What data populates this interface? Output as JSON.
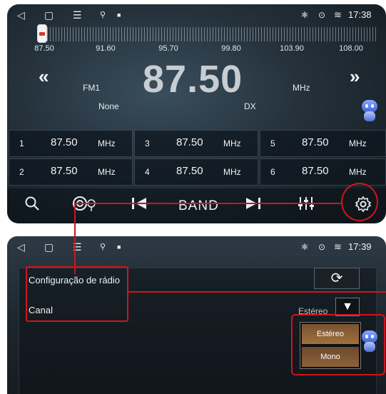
{
  "status_top": {
    "time": "17:38"
  },
  "status_bottom": {
    "time": "17:39"
  },
  "dial": {
    "ticks": [
      "87.50",
      "91.60",
      "95.70",
      "99.80",
      "103.90",
      "108.00"
    ]
  },
  "radio": {
    "prev_label": "«",
    "next_label": "»",
    "band": "FM1",
    "frequency": "87.50",
    "unit": "MHz",
    "rds_name": "None",
    "dx": "DX"
  },
  "presets": [
    {
      "num": "1",
      "value": "87.50",
      "unit": "MHz"
    },
    {
      "num": "3",
      "value": "87.50",
      "unit": "MHz"
    },
    {
      "num": "5",
      "value": "87.50",
      "unit": "MHz"
    },
    {
      "num": "2",
      "value": "87.50",
      "unit": "MHz"
    },
    {
      "num": "4",
      "value": "87.50",
      "unit": "MHz"
    },
    {
      "num": "6",
      "value": "87.50",
      "unit": "MHz"
    }
  ],
  "toolbar": {
    "search_icon": "search-icon",
    "podcast_icon": "podcast-icon",
    "prev_icon": "skip-previous-icon",
    "band_label": "BAND",
    "next_icon": "skip-next-icon",
    "eq_icon": "equalizer-icon",
    "settings_icon": "gear-icon"
  },
  "settings": {
    "title": "Configuração de rádio",
    "channel_label": "Canal",
    "channel_value": "Estéreo",
    "refresh_icon": "refresh-icon",
    "options": [
      "Estéreo",
      "Mono"
    ]
  },
  "colors": {
    "accent_red": "#d0141c",
    "dropdown_brown": "#a0703e"
  }
}
